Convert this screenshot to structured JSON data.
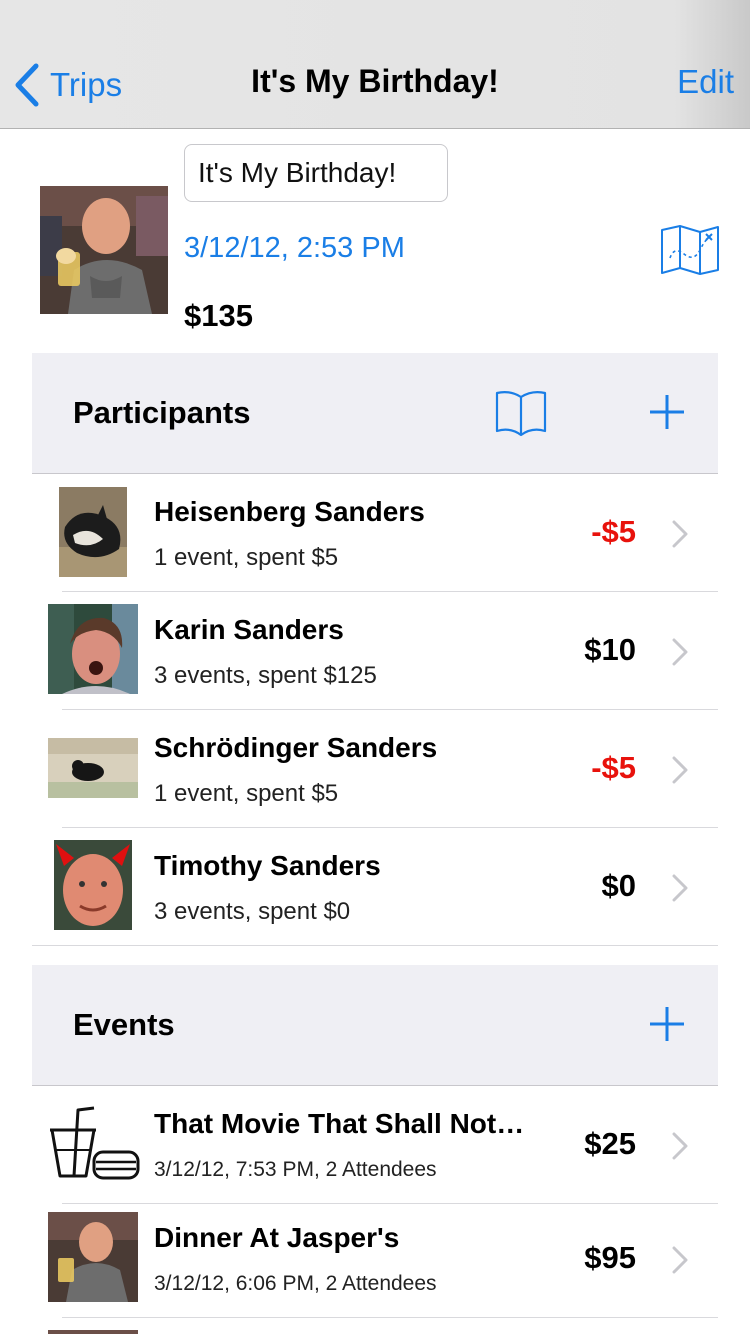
{
  "nav": {
    "back_label": "Trips",
    "title": "It's My Birthday!",
    "edit_label": "Edit"
  },
  "trip": {
    "name": "It's My Birthday!",
    "date": "3/12/12, 2:53 PM",
    "total": "$135"
  },
  "participants_section": {
    "title": "Participants"
  },
  "participants": [
    {
      "name": "Heisenberg Sanders",
      "summary": "1 event, spent $5",
      "amount": "-$5"
    },
    {
      "name": "Karin Sanders",
      "summary": "3 events, spent $125",
      "amount": "$10"
    },
    {
      "name": "Schrödinger Sanders",
      "summary": "1 event, spent $5",
      "amount": "-$5"
    },
    {
      "name": "Timothy Sanders",
      "summary": "3 events, spent $0",
      "amount": "$0"
    }
  ],
  "events_section": {
    "title": "Events"
  },
  "events": [
    {
      "name": "That Movie That Shall Not…",
      "summary": "3/12/12, 7:53 PM, 2 Attendees",
      "amount": "$25"
    },
    {
      "name": "Dinner At Jasper's",
      "summary": "3/12/12, 6:06 PM, 2 Attendees",
      "amount": "$95"
    }
  ],
  "colors": {
    "accent": "#1a7ee6",
    "negative": "#e8120c",
    "section_bg": "#efeff4"
  }
}
